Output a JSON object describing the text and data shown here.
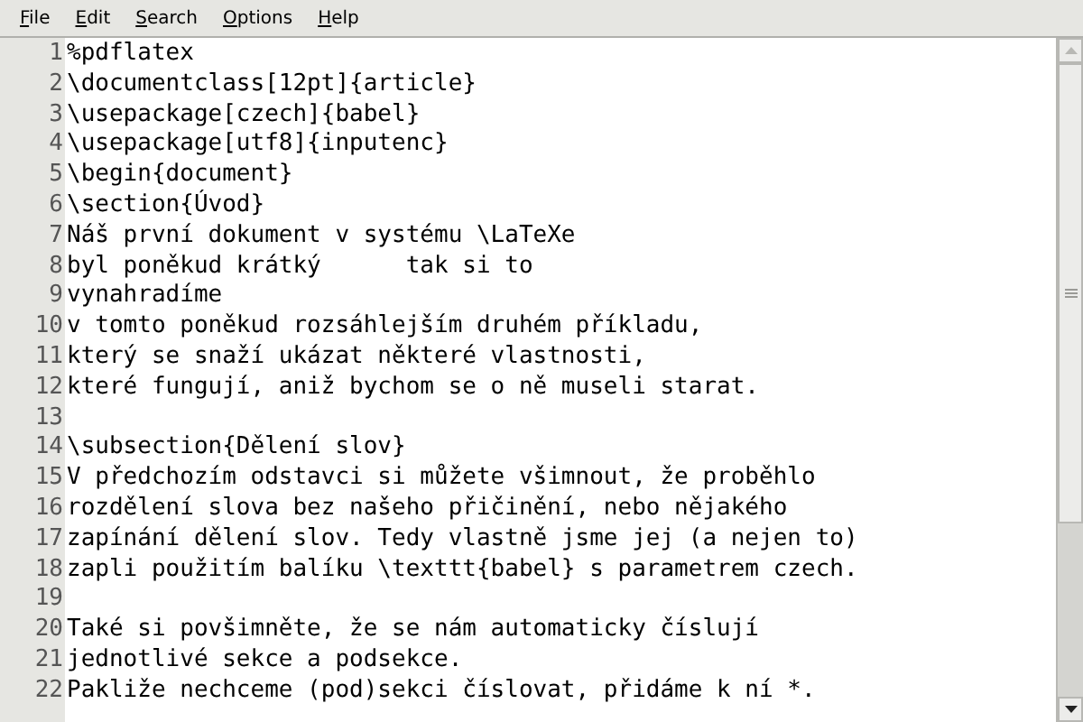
{
  "menu": [
    {
      "label": "File"
    },
    {
      "label": "Edit"
    },
    {
      "label": "Search"
    },
    {
      "label": "Options"
    },
    {
      "label": "Help"
    }
  ],
  "editor": {
    "lines": [
      {
        "number": "1",
        "text": "%pdflatex"
      },
      {
        "number": "2",
        "text": "\\documentclass[12pt]{article}"
      },
      {
        "number": "3",
        "text": "\\usepackage[czech]{babel}"
      },
      {
        "number": "4",
        "text": "\\usepackage[utf8]{inputenc}"
      },
      {
        "number": "5",
        "text": "\\begin{document}"
      },
      {
        "number": "6",
        "text": "\\section{Úvod}"
      },
      {
        "number": "7",
        "text": "Náš první dokument v systému \\LaTeXe"
      },
      {
        "number": "8",
        "text": "byl poněkud krátký      tak si to"
      },
      {
        "number": "9",
        "text": "vynahradíme"
      },
      {
        "number": "10",
        "text": "v tomto poněkud rozsáhlejším druhém příkladu,"
      },
      {
        "number": "11",
        "text": "který se snaží ukázat některé vlastnosti,"
      },
      {
        "number": "12",
        "text": "které fungují, aniž bychom se o ně museli starat."
      },
      {
        "number": "13"
      },
      {
        "number": "14",
        "text": "\\subsection{Dělení slov}"
      },
      {
        "number": "15",
        "text": "V předchozím odstavci si můžete všimnout, že proběhlo"
      },
      {
        "number": "16",
        "text": "rozdělení slova bez našeho přičinění, nebo nějakého"
      },
      {
        "number": "17",
        "text": "zapínání dělení slov. Tedy vlastně jsme jej (a nejen to)"
      },
      {
        "number": "18",
        "text": "zapli použitím balíku \\texttt{babel} s parametrem czech."
      },
      {
        "number": "19"
      },
      {
        "number": "20",
        "text": "Také si povšimněte, že se nám automaticky číslují"
      },
      {
        "number": "21",
        "text": "jednotlivé sekce a podsekce."
      },
      {
        "number": "22",
        "text": "Pakliže nechceme (pod)sekci číslovat, přidáme k ní *."
      }
    ]
  }
}
